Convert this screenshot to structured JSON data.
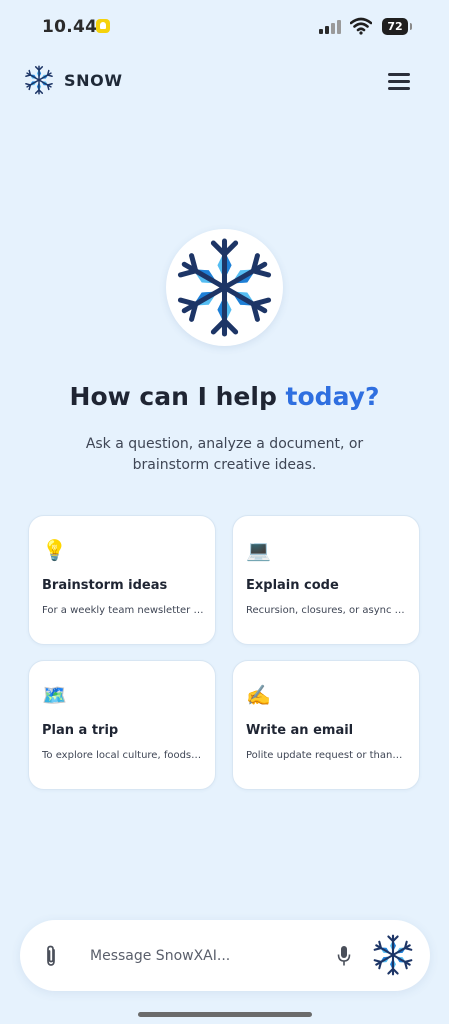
{
  "status_bar": {
    "time": "10.44",
    "battery": "72"
  },
  "header": {
    "brand_name": "SNOW"
  },
  "hero": {
    "title_main": "How can I help ",
    "title_accent": "today?",
    "subtitle": "Ask a question, analyze a document, or brainstorm creative ideas."
  },
  "suggestions": [
    {
      "icon": "💡",
      "title": "Brainstorm ideas",
      "description": "For a weekly team newsletter o..."
    },
    {
      "icon": "💻",
      "title": "Explain code",
      "description": "Recursion, closures, or async pr..."
    },
    {
      "icon": "🗺️",
      "title": "Plan a trip",
      "description": "To explore local culture, foods, ..."
    },
    {
      "icon": "✍️",
      "title": "Write an email",
      "description": "Polite update request or thank ..."
    }
  ],
  "composer": {
    "placeholder": "Message SnowXAI..."
  },
  "colors": {
    "background": "#e6f2fd",
    "accent": "#2f6fe0",
    "snowflake_dark": "#1d3566",
    "snowflake_light": "#55bdf2"
  }
}
